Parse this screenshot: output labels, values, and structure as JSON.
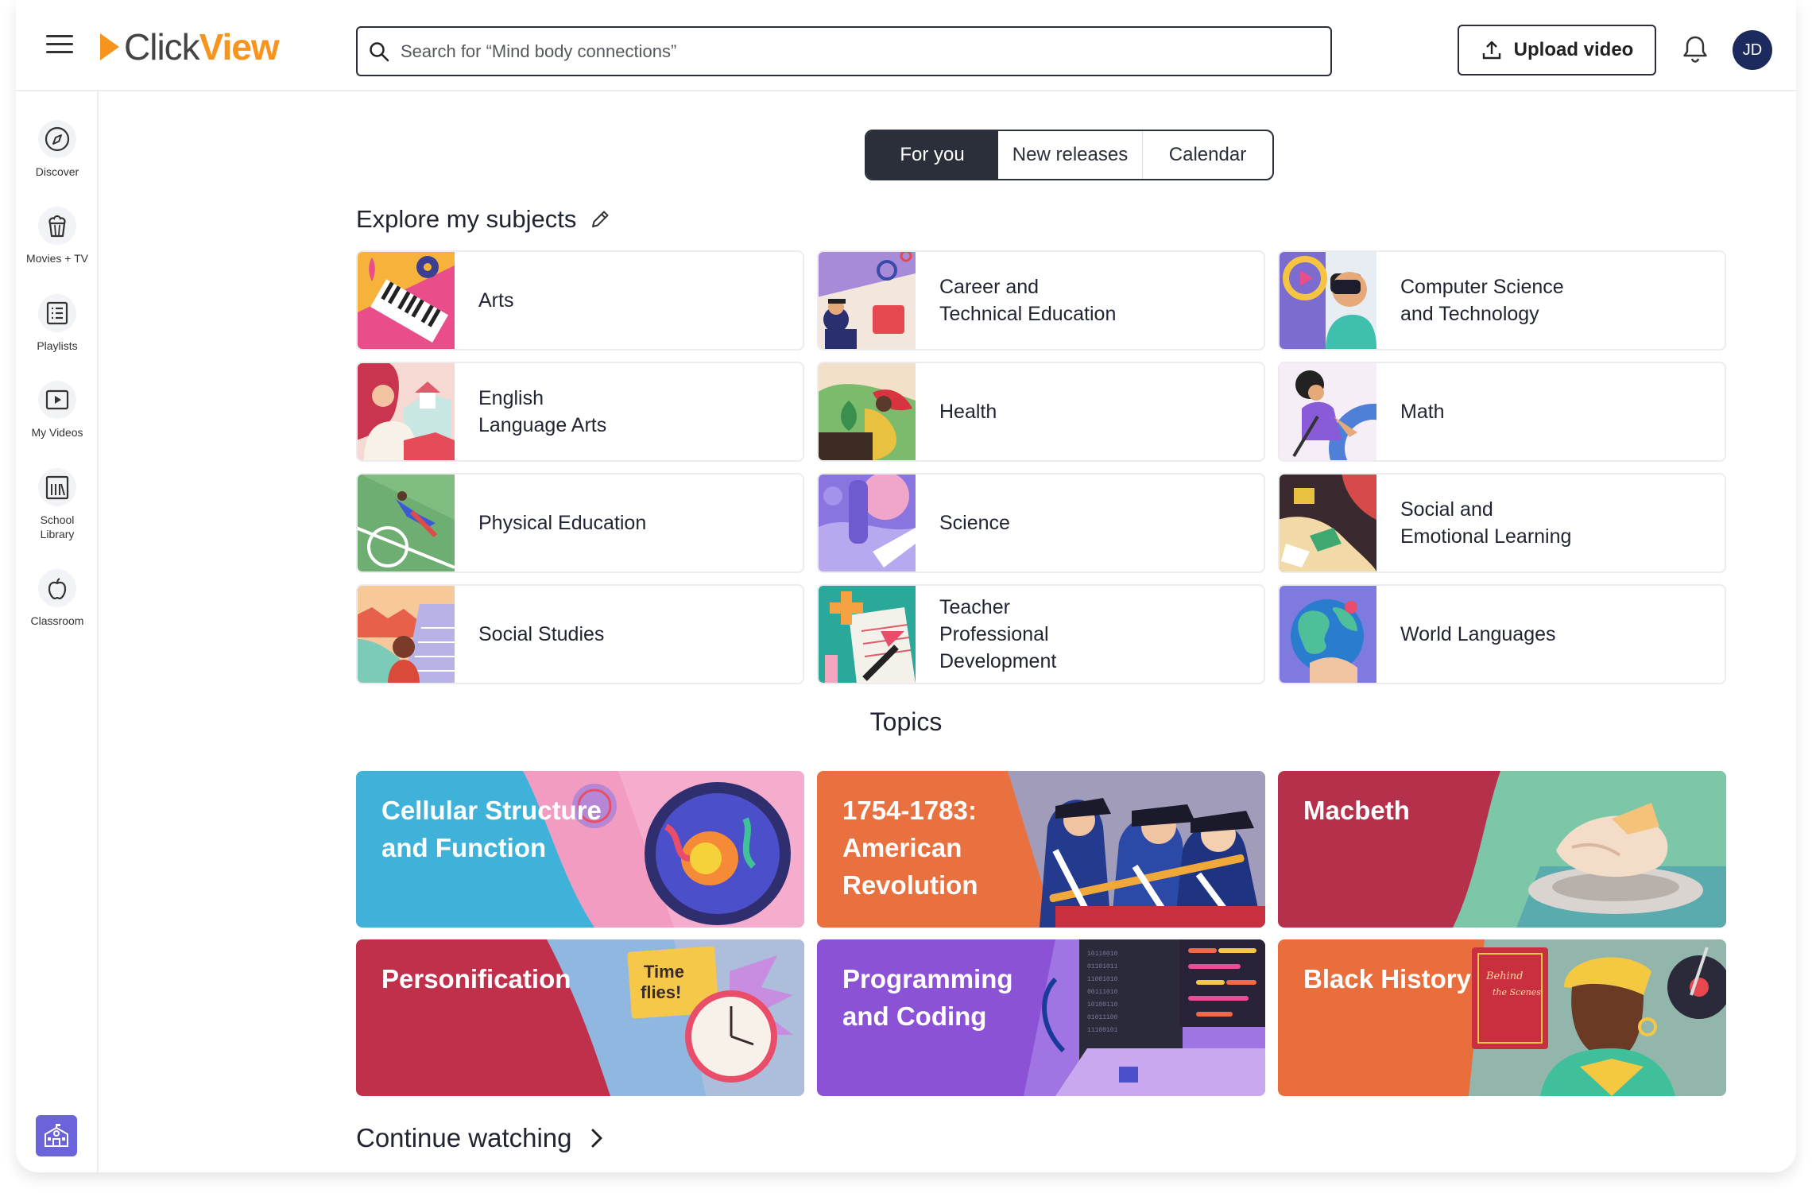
{
  "app": {
    "logo_word1": "Click",
    "logo_word2": "View"
  },
  "header": {
    "search_placeholder": "Search for “Mind body connections”",
    "upload_label": "Upload video",
    "avatar_initials": "JD"
  },
  "sidebar": {
    "items": [
      {
        "label": "Discover",
        "icon": "compass-icon"
      },
      {
        "label": "Movies + TV",
        "icon": "popcorn-icon"
      },
      {
        "label": "Playlists",
        "icon": "list-icon"
      },
      {
        "label": "My Videos",
        "icon": "play-icon"
      },
      {
        "label": "School\nLibrary",
        "icon": "library-icon"
      },
      {
        "label": "Classroom",
        "icon": "apple-icon"
      }
    ],
    "bottom_icon": "school-icon"
  },
  "tabs": [
    {
      "label": "For you",
      "active": true
    },
    {
      "label": "New releases",
      "active": false
    },
    {
      "label": "Calendar",
      "active": false
    }
  ],
  "explore": {
    "title": "Explore my subjects"
  },
  "subjects": [
    {
      "name": "Arts"
    },
    {
      "name": "Career and\nTechnical Education"
    },
    {
      "name": "Computer Science\nand Technology"
    },
    {
      "name": "English\nLanguage Arts"
    },
    {
      "name": "Health"
    },
    {
      "name": "Math"
    },
    {
      "name": "Physical Education"
    },
    {
      "name": "Science"
    },
    {
      "name": "Social and\nEmotional Learning"
    },
    {
      "name": "Social Studies"
    },
    {
      "name": "Teacher\nProfessional\nDevelopment"
    },
    {
      "name": "World Languages"
    }
  ],
  "topics_title": "Topics",
  "topics": [
    {
      "name": "Cellular Structure\nand Function",
      "color": "#3fb2d9"
    },
    {
      "name": "1754-1783:\nAmerican\nRevolution",
      "color": "#e9713f"
    },
    {
      "name": "Macbeth",
      "color": "#b5304b"
    },
    {
      "name": "Personification",
      "color": "#c0304a"
    },
    {
      "name": "Programming\nand Coding",
      "color": "#8b52d6"
    },
    {
      "name": "Black History",
      "color": "#e96e3c"
    }
  ],
  "continue_label": "Continue watching",
  "colors": {
    "accent": "#f7941d",
    "dark": "#2b2f3a",
    "avatar": "#1c2a5e",
    "school_button": "#6b63d9"
  }
}
